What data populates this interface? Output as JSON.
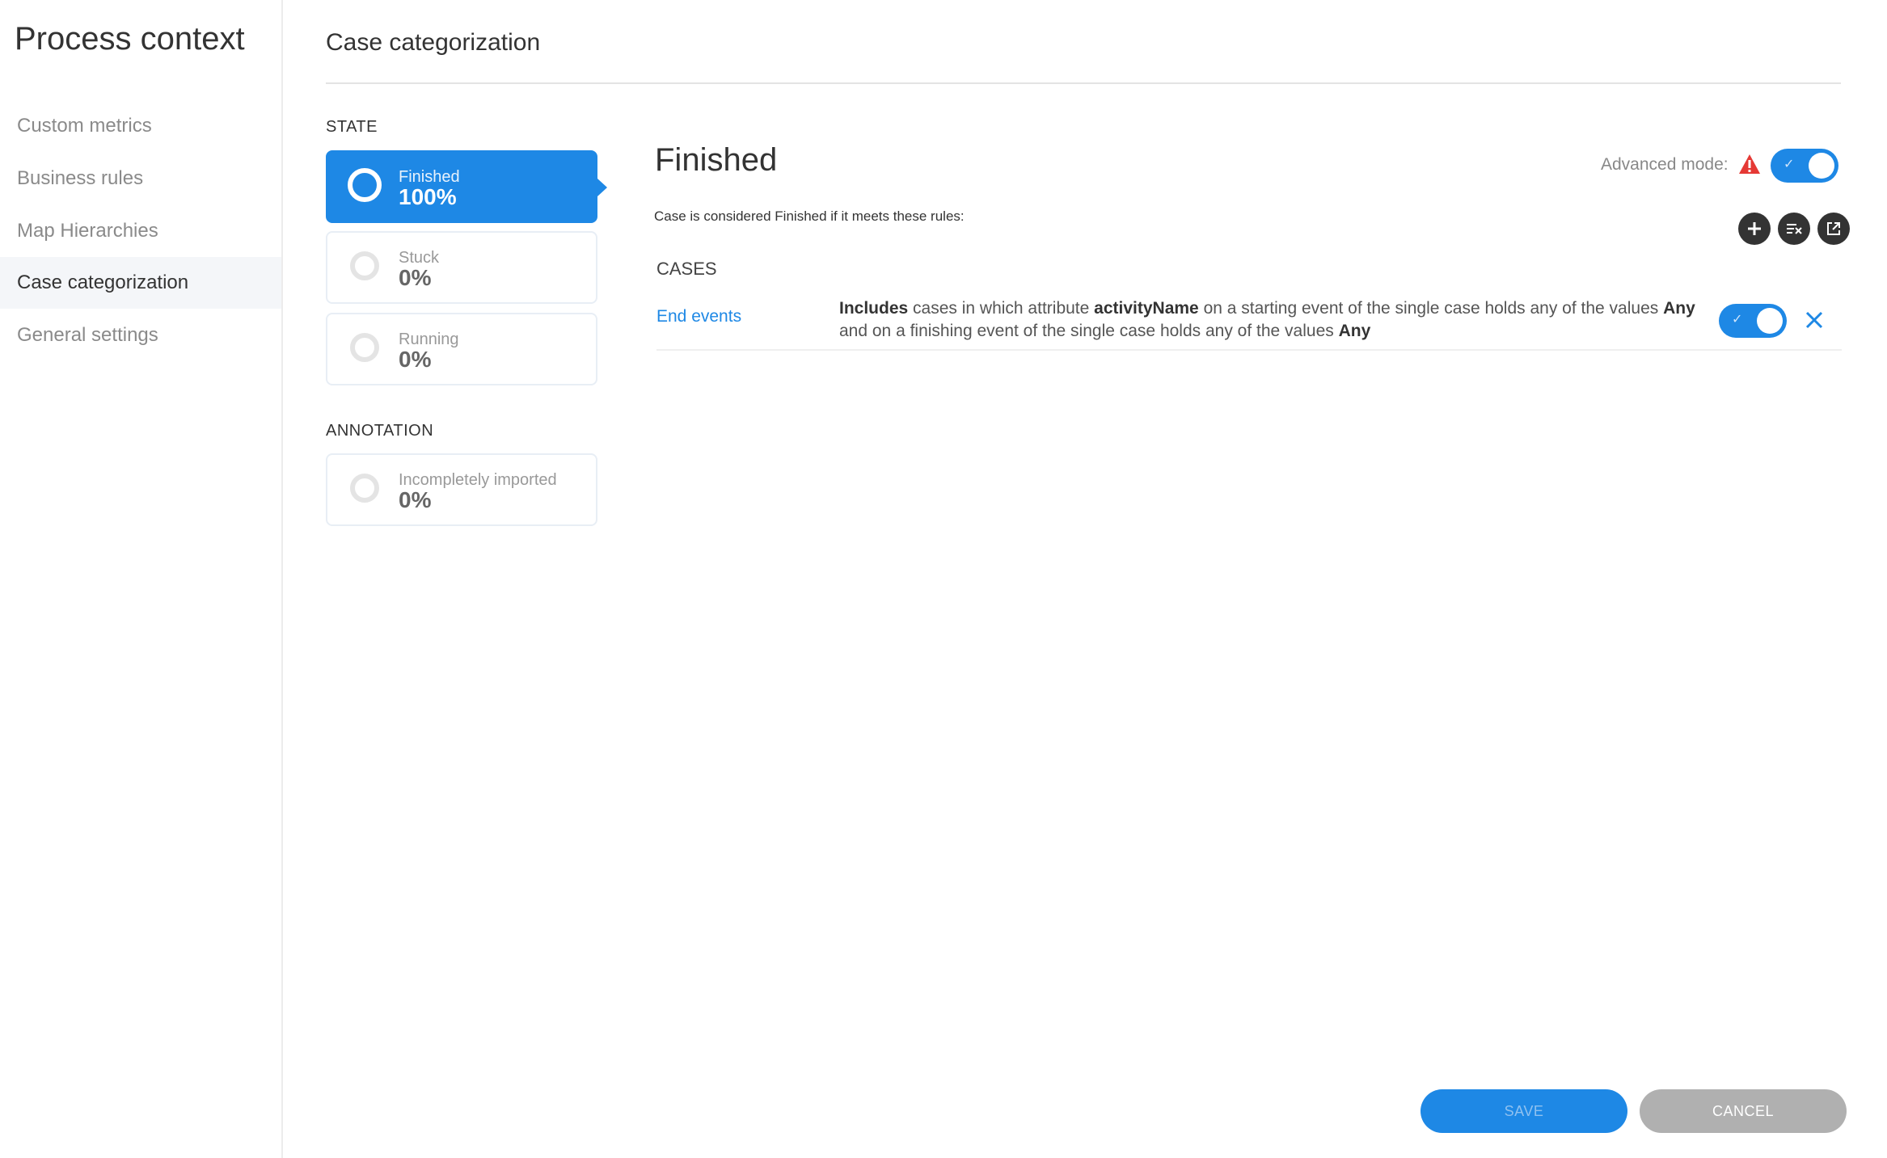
{
  "sidebar": {
    "title": "Process context",
    "items": [
      {
        "label": "Custom metrics"
      },
      {
        "label": "Business rules"
      },
      {
        "label": "Map Hierarchies"
      },
      {
        "label": "Case categorization",
        "active": true
      },
      {
        "label": "General settings"
      }
    ]
  },
  "header": {
    "title": "Case categorization"
  },
  "state": {
    "section_label": "STATE",
    "cards": [
      {
        "label": "Finished",
        "percent": "100%",
        "active": true
      },
      {
        "label": "Stuck",
        "percent": "0%"
      },
      {
        "label": "Running",
        "percent": "0%"
      }
    ]
  },
  "annotation": {
    "section_label": "ANNOTATION",
    "cards": [
      {
        "label": "Incompletely imported",
        "percent": "0%"
      }
    ]
  },
  "detail": {
    "title": "Finished",
    "advanced_mode_label": "Advanced mode:",
    "advanced_mode_on": true,
    "rule_caption": "Case is considered Finished if it meets these rules:",
    "actions": [
      "add-icon",
      "clear-filter-icon",
      "export-icon"
    ],
    "cases_label": "CASES",
    "rules": [
      {
        "name": "End events",
        "enabled": true,
        "text": {
          "w1": "Includes",
          "t1": " cases in which attribute ",
          "w2": "activityName",
          "t2": " on a starting event of the single case holds any of the values ",
          "w3": "Any",
          "t3": " and on a finishing event of the single case holds any of the values ",
          "w4": "Any"
        }
      }
    ]
  },
  "footer": {
    "save_label": "SAVE",
    "cancel_label": "CANCEL"
  },
  "colors": {
    "accent": "#1e88e5",
    "warning": "#e53935",
    "dark_button": "#333333",
    "cancel": "#b0b0b0"
  }
}
